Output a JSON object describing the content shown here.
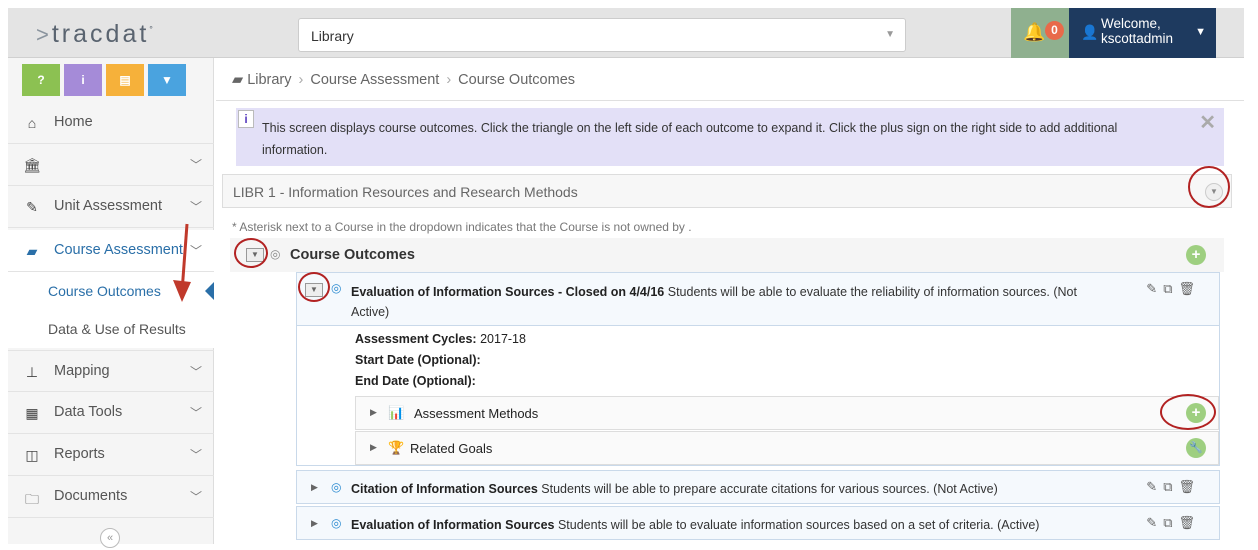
{
  "header": {
    "logo": "tracdat",
    "library_select": "Library",
    "notifications": "0",
    "welcome_line1": "Welcome,",
    "welcome_line2": "kscottadmin"
  },
  "toolbar": {
    "help": "?",
    "info": "i",
    "notes": "▤",
    "filter": "▼"
  },
  "sidebar": {
    "items": [
      {
        "label": "Home",
        "icon": "home-icon"
      },
      {
        "label": "",
        "icon": "institution-icon"
      },
      {
        "label": "Unit Assessment",
        "icon": "pencil-icon"
      },
      {
        "label": "Course Assessment",
        "icon": "book-icon"
      },
      {
        "label": "Mapping",
        "icon": "sitemap-icon"
      },
      {
        "label": "Data Tools",
        "icon": "table-icon"
      },
      {
        "label": "Reports",
        "icon": "columns-icon"
      },
      {
        "label": "Documents",
        "icon": "folder-icon"
      }
    ],
    "sub_items": [
      "Course Outcomes",
      "Data & Use of Results"
    ],
    "collapse": "«"
  },
  "breadcrumb": {
    "root": "Library",
    "level2": "Course Assessment",
    "level3": "Course Outcomes"
  },
  "info_text": "This screen displays course outcomes. Click the triangle on the left side of each outcome to expand it. Click the plus sign on the right side to add additional information.",
  "course_select": "LIBR 1 - Information Resources and Research Methods",
  "note": "* Asterisk next to a Course in the dropdown indicates that the Course is not owned by .",
  "section_title": "Course Outcomes",
  "outcomes": [
    {
      "title": "Evaluation of Information Sources - Closed on 4/4/16",
      "desc": " Students will be able to evaluate the reliability of information sources. (Not Active)",
      "cycles_label": "Assessment Cycles:",
      "cycles_value": " 2017-18",
      "start_label": "Start Date (Optional):",
      "end_label": "End Date (Optional):",
      "methods_label": "Assessment Methods",
      "goals_label": "Related Goals"
    },
    {
      "title": "Citation of Information Sources",
      "desc": " Students will be able to prepare accurate citations for various sources. (Not Active)"
    },
    {
      "title": "Evaluation of Information Sources",
      "desc": " Students will be able to evaluate information sources based on a set of criteria. (Active)"
    }
  ],
  "colors": {
    "accent": "#2a6fa8",
    "header_dark": "#1e3a5f",
    "info_bg": "#e3e0f7",
    "plus_green": "#9ecf80",
    "annotation_red": "#b22222"
  }
}
